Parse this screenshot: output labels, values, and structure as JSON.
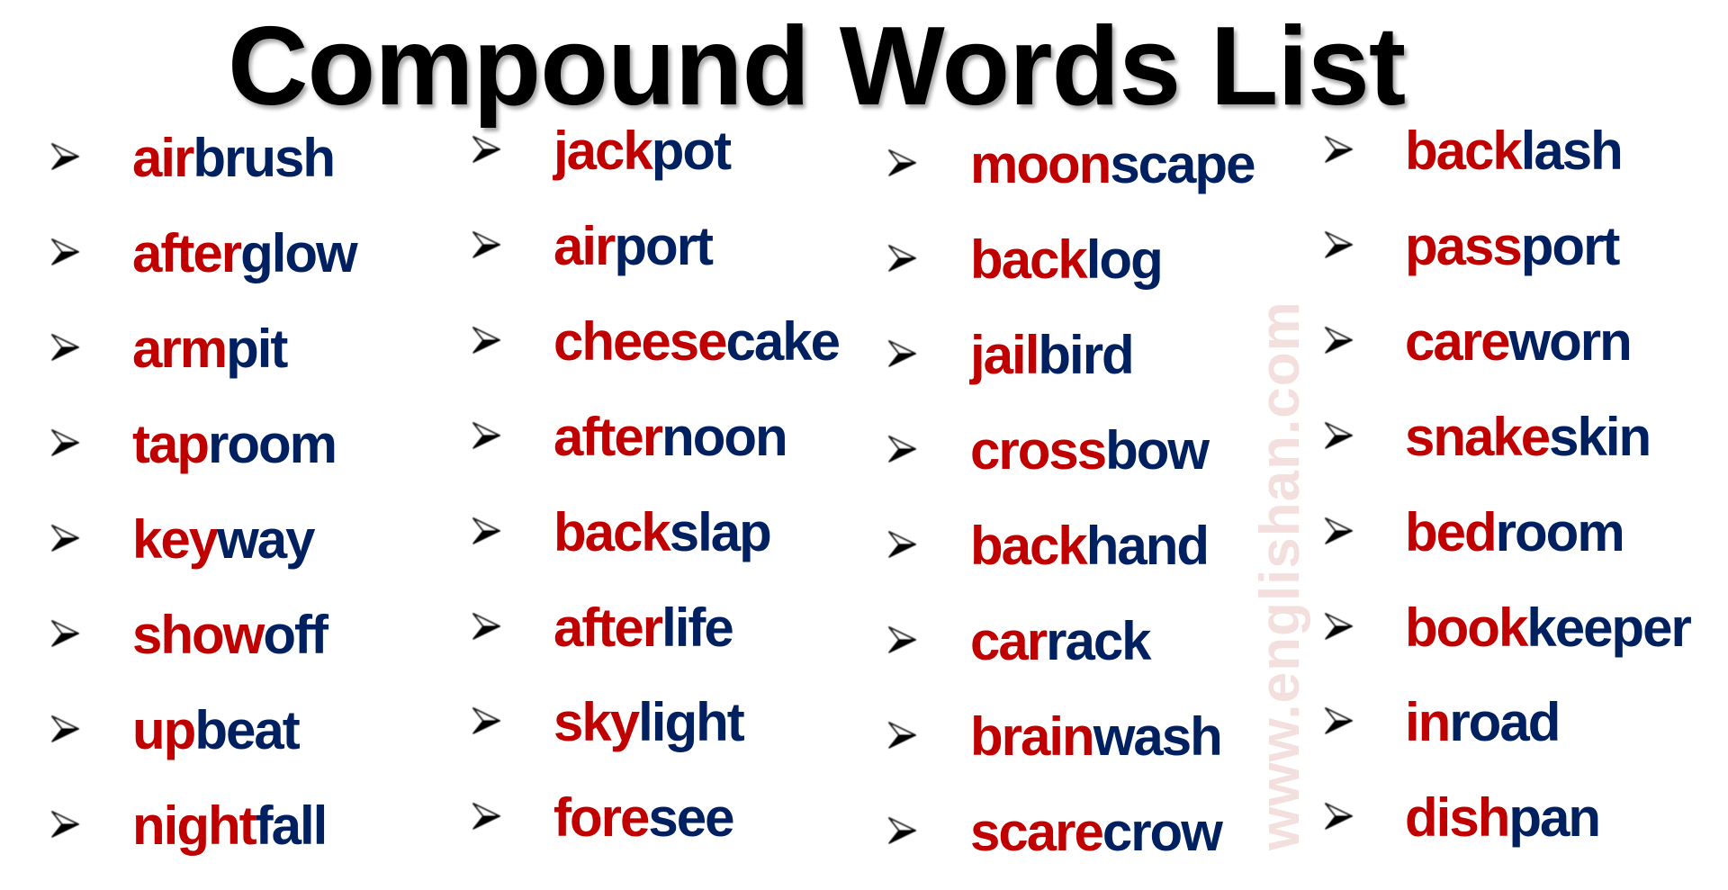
{
  "title": "Compound Words List",
  "watermark": "www.englishan.com",
  "colors": {
    "first_part": "#c00000",
    "second_part": "#002060",
    "title": "#000000",
    "watermark": "#f4dfdf"
  },
  "bullet_icon": "arrowhead-bullet-icon",
  "columns": [
    {
      "words": [
        {
          "a": "air",
          "b": "brush"
        },
        {
          "a": "after",
          "b": "glow"
        },
        {
          "a": "arm",
          "b": "pit"
        },
        {
          "a": "tap",
          "b": "room"
        },
        {
          "a": "key",
          "b": "way"
        },
        {
          "a": "show",
          "b": "off"
        },
        {
          "a": "up",
          "b": "beat"
        },
        {
          "a": "night",
          "b": "fall"
        }
      ]
    },
    {
      "words": [
        {
          "a": "jack",
          "b": "pot"
        },
        {
          "a": "air",
          "b": "port"
        },
        {
          "a": "cheese",
          "b": "cake"
        },
        {
          "a": "after",
          "b": "noon"
        },
        {
          "a": "back",
          "b": "slap"
        },
        {
          "a": "after",
          "b": "life"
        },
        {
          "a": "sky",
          "b": "light"
        },
        {
          "a": "fore",
          "b": "see"
        }
      ]
    },
    {
      "words": [
        {
          "a": "moon",
          "b": "scape"
        },
        {
          "a": "back",
          "b": "log"
        },
        {
          "a": "jail",
          "b": "bird"
        },
        {
          "a": "cross",
          "b": "bow"
        },
        {
          "a": "back",
          "b": "hand"
        },
        {
          "a": "car",
          "b": "rack"
        },
        {
          "a": "brain",
          "b": "wash"
        },
        {
          "a": "scare",
          "b": "crow"
        }
      ]
    },
    {
      "words": [
        {
          "a": "back",
          "b": "lash"
        },
        {
          "a": "pass",
          "b": "port"
        },
        {
          "a": "care",
          "b": "worn"
        },
        {
          "a": "snake",
          "b": "skin"
        },
        {
          "a": "bed",
          "b": "room"
        },
        {
          "a": "book",
          "b": "keeper"
        },
        {
          "a": "in",
          "b": "road"
        },
        {
          "a": "dish",
          "b": "pan"
        }
      ]
    }
  ]
}
